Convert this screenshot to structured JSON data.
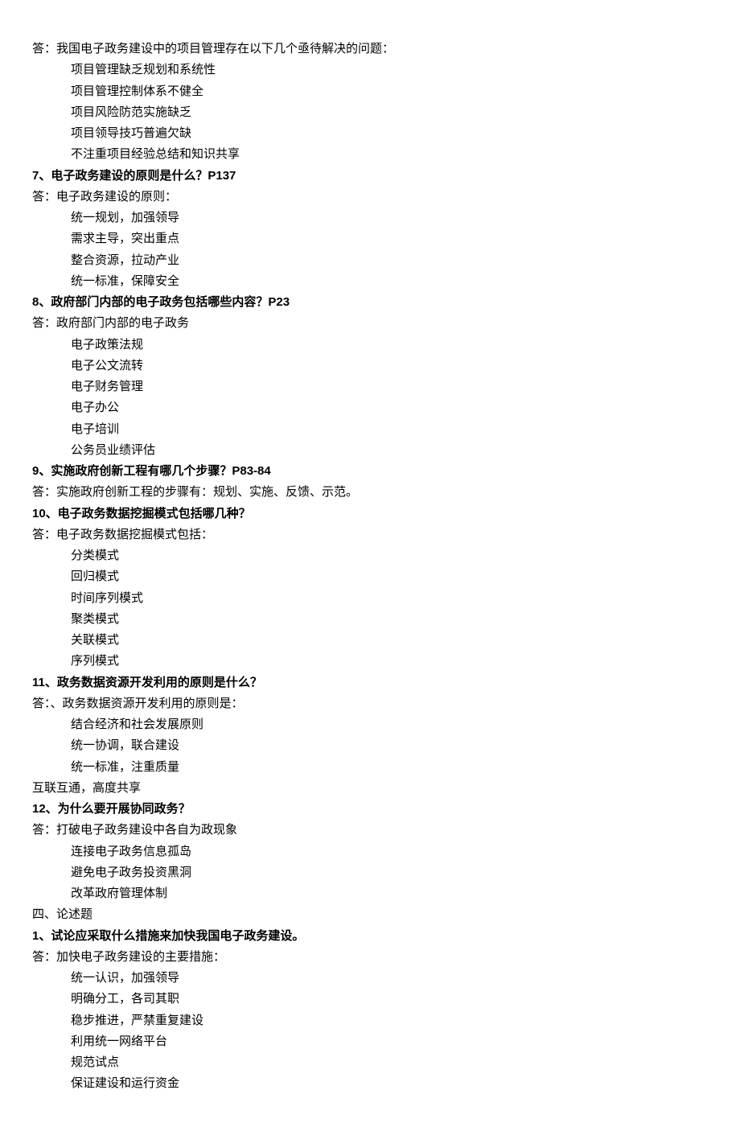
{
  "lines": [
    {
      "text": "答：我国电子政务建设中的项目管理存在以下几个亟待解决的问题：",
      "bold": false,
      "indent": 0
    },
    {
      "text": "项目管理缺乏规划和系统性",
      "bold": false,
      "indent": 1
    },
    {
      "text": "项目管理控制体系不健全",
      "bold": false,
      "indent": 1
    },
    {
      "text": "项目风险防范实施缺乏",
      "bold": false,
      "indent": 1
    },
    {
      "text": "项目领导技巧普遍欠缺",
      "bold": false,
      "indent": 1
    },
    {
      "text": "不注重项目经验总结和知识共享",
      "bold": false,
      "indent": 1
    },
    {
      "text": "7、电子政务建设的原则是什么？P137",
      "bold": true,
      "indent": 0
    },
    {
      "text": "答：电子政务建设的原则：",
      "bold": false,
      "indent": 0
    },
    {
      "text": "统一规划，加强领导",
      "bold": false,
      "indent": 1
    },
    {
      "text": "需求主导，突出重点",
      "bold": false,
      "indent": 1
    },
    {
      "text": "整合资源，拉动产业",
      "bold": false,
      "indent": 1
    },
    {
      "text": "统一标准，保障安全",
      "bold": false,
      "indent": 1
    },
    {
      "text": "8、政府部门内部的电子政务包括哪些内容？P23",
      "bold": true,
      "indent": 0
    },
    {
      "text": "答：政府部门内部的电子政务",
      "bold": false,
      "indent": 0
    },
    {
      "text": "电子政策法规",
      "bold": false,
      "indent": 1
    },
    {
      "text": "电子公文流转",
      "bold": false,
      "indent": 1
    },
    {
      "text": "电子财务管理",
      "bold": false,
      "indent": 1
    },
    {
      "text": "电子办公",
      "bold": false,
      "indent": 1
    },
    {
      "text": "电子培训",
      "bold": false,
      "indent": 1
    },
    {
      "text": "公务员业绩评估",
      "bold": false,
      "indent": 1
    },
    {
      "text": "9、实施政府创新工程有哪几个步骤？P83-84",
      "bold": true,
      "indent": 0
    },
    {
      "text": "答：实施政府创新工程的步骤有：规划、实施、反馈、示范。",
      "bold": false,
      "indent": 0
    },
    {
      "text": "10、电子政务数据挖掘模式包括哪几种？",
      "bold": true,
      "indent": 0
    },
    {
      "text": "答：电子政务数据挖掘模式包括：",
      "bold": false,
      "indent": 0
    },
    {
      "text": "分类模式",
      "bold": false,
      "indent": 1
    },
    {
      "text": "回归模式",
      "bold": false,
      "indent": 1
    },
    {
      "text": "时间序列模式",
      "bold": false,
      "indent": 1
    },
    {
      "text": "聚类模式",
      "bold": false,
      "indent": 1
    },
    {
      "text": "关联模式",
      "bold": false,
      "indent": 1
    },
    {
      "text": "序列模式",
      "bold": false,
      "indent": 1
    },
    {
      "text": "11、政务数据资源开发利用的原则是什么？",
      "bold": true,
      "indent": 0
    },
    {
      "text": "答：、政务数据资源开发利用的原则是：",
      "bold": false,
      "indent": 0
    },
    {
      "text": "结合经济和社会发展原则",
      "bold": false,
      "indent": 1
    },
    {
      "text": "统一协调，联合建设",
      "bold": false,
      "indent": 1
    },
    {
      "text": "统一标准，注重质量",
      "bold": false,
      "indent": 1
    },
    {
      "text": "互联互通，高度共享",
      "bold": false,
      "indent": 0
    },
    {
      "text": "12、为什么要开展协同政务？",
      "bold": true,
      "indent": 0
    },
    {
      "text": "答：打破电子政务建设中各自为政现象",
      "bold": false,
      "indent": 0
    },
    {
      "text": "连接电子政务信息孤岛",
      "bold": false,
      "indent": 1
    },
    {
      "text": "避免电子政务投资黑洞",
      "bold": false,
      "indent": 1
    },
    {
      "text": "改革政府管理体制",
      "bold": false,
      "indent": 1
    },
    {
      "text": "四、论述题",
      "bold": false,
      "indent": 0
    },
    {
      "text": "1、试论应采取什么措施来加快我国电子政务建设。",
      "bold": true,
      "indent": 0
    },
    {
      "text": "答：加快电子政务建设的主要措施：",
      "bold": false,
      "indent": 0
    },
    {
      "text": "统一认识，加强领导",
      "bold": false,
      "indent": 1
    },
    {
      "text": "明确分工，各司其职",
      "bold": false,
      "indent": 1
    },
    {
      "text": "稳步推进，严禁重复建设",
      "bold": false,
      "indent": 1
    },
    {
      "text": "利用统一网络平台",
      "bold": false,
      "indent": 1
    },
    {
      "text": "规范试点",
      "bold": false,
      "indent": 1
    },
    {
      "text": "保证建设和运行资金",
      "bold": false,
      "indent": 1
    }
  ]
}
